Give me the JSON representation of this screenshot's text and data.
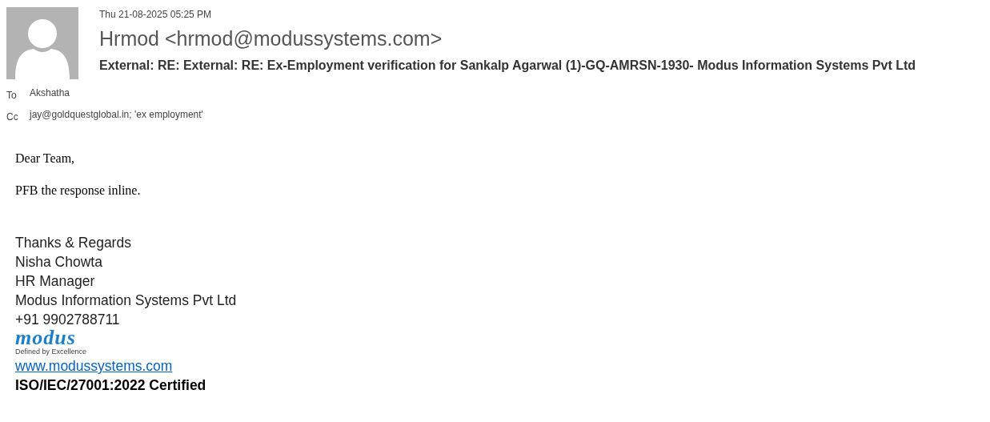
{
  "header": {
    "date": "Thu 21-08-2025 05:25 PM",
    "sender": "Hrmod <hrmod@modussystems.com>",
    "subject": "External: RE: External: RE: Ex-Employment verification for Sankalp Agarwal (1)-GQ-AMRSN-1930- Modus Information Systems Pvt Ltd",
    "recipients": [
      {
        "label": "To",
        "value": "Akshatha"
      },
      {
        "label": "Cc",
        "value": "jay@goldquestglobal.in; 'ex employment'"
      }
    ]
  },
  "body": {
    "paragraphs": [
      "Dear Team,",
      "PFB the response inline."
    ],
    "signature": {
      "lines": [
        "Thanks & Regards",
        "Nisha Chowta",
        "HR Manager",
        "Modus Information Systems Pvt Ltd",
        "+91 9902788711"
      ],
      "logo": {
        "wordmark": "modus",
        "tagline": "Defined by Excellence"
      },
      "link": "www.modussystems.com",
      "certification": "ISO/IEC/27001:2022 Certified"
    }
  }
}
